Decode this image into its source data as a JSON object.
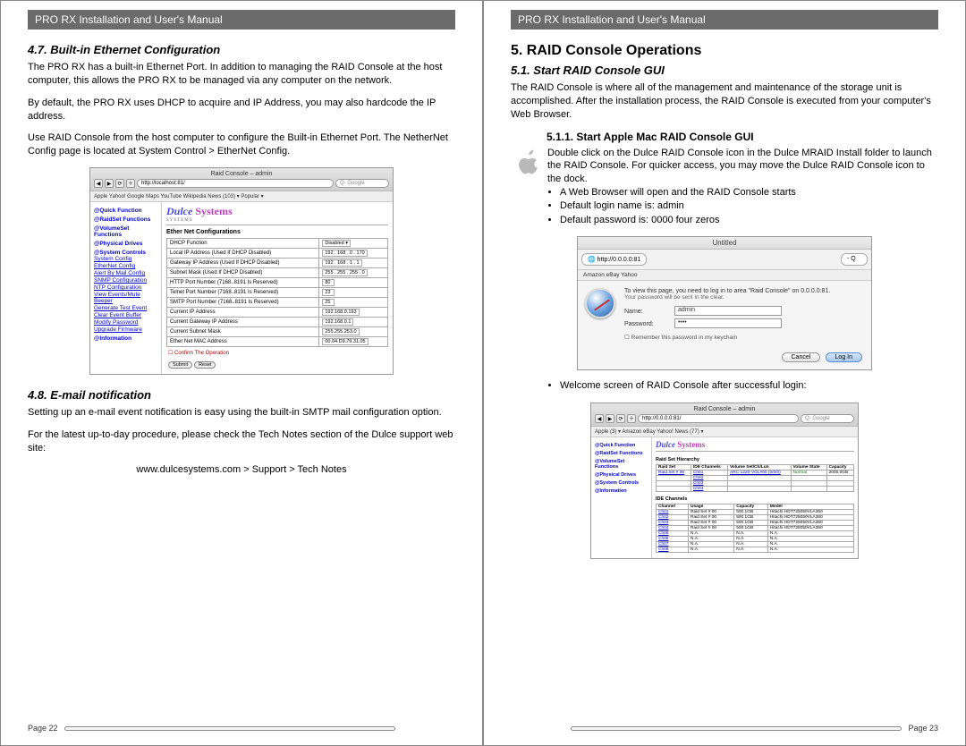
{
  "header": "PRO RX Installation and User's Manual",
  "left": {
    "sec47": "4.7.    Built-in Ethernet Configuration",
    "p47a": "The PRO RX has a built-in Ethernet Port.  In addition to managing the RAID Console at the host computer, this allows the PRO RX to be managed via any computer on the network.",
    "p47b": "By default, the PRO RX uses DHCP to acquire and IP Address, you may also hardcode the IP address.",
    "p47c": "Use RAID Console from the host computer to configure the Built-in Ethernet Port. The NetherNet Config page is located at System Control > EtherNet Config.",
    "sec48": "4.8.    E-mail notification",
    "p48a": "Setting up an e-mail event notification is easy using the built-in SMTP mail configuration option.",
    "p48b": "For the latest up-to-day procedure, please check the Tech Notes section of the Dulce support web site:",
    "p48link": "www.dulcesystems.com > Support > Tech Notes",
    "page_num": "Page 22"
  },
  "right": {
    "h5": "5. RAID Console Operations",
    "sec51": "5.1.    Start RAID Console GUI",
    "p51": "The RAID Console is where all of the management and maintenance of the storage unit is accomplished.  After the installation process, the RAID Console is executed from your computer's Web Browser.",
    "sec511": "5.1.1. Start Apple Mac RAID Console GUI",
    "p511": "Double click on the Dulce RAID Console icon in the Dulce MRAID Install folder to launch the RAID Console.  For quicker access, you may move the Dulce RAID Console icon to the dock.",
    "bullets": [
      "A Web Browser will open and the RAID Console starts",
      "Default login name is: admin",
      "Default password is: 0000   four zeros"
    ],
    "after_login": "Welcome screen of RAID Console after successful login:",
    "page_num": "Page 23"
  },
  "shot1": {
    "window_title": "Raid Console – admin",
    "url": "http://localhost:81/",
    "search_ph": "Google",
    "bookmarks": "Apple   Yahoo!   Google Maps   YouTube   Wikipedia   News (103) ▾   Popular ▾",
    "sidebar": {
      "quick": "@Quick Function",
      "rsf": "@RaidSet Functions",
      "vsf": "@VolumeSet Functions",
      "pd": "@Physical Drives",
      "sc": "@System Controls",
      "sc_items": [
        "System Config",
        "EtherNet Config",
        "Alert By Mail Config",
        "SNMP Configuration",
        "NTP Configuration",
        "View Events/Mute Beeper",
        "Generate Test Event",
        "Clear Event Buffer",
        "Modify Password",
        "Upgrade Firmware"
      ],
      "info": "@Information"
    },
    "logo_main": "Dulce",
    "logo_sub": "Systems",
    "form_title": "Ether Net Configurations",
    "rows": [
      {
        "label": "DHCP Function",
        "val": "Disabled ▾"
      },
      {
        "label": "Local IP Address (Used If DHCP Disabled)",
        "val": "192 . 168 . 0 . 170"
      },
      {
        "label": "Gateway IP Address (Used If DHCP Disabled)",
        "val": "192 . 168 . 1 . 1"
      },
      {
        "label": "Subnet Mask (Used If DHCP Disabled)",
        "val": "255 . 255 . 255 . 0"
      },
      {
        "label": "HTTP Port Number (7168..8191 Is Reserved)",
        "val": "80"
      },
      {
        "label": "Telnet Port Number (7168..8191 Is Reserved)",
        "val": "23"
      },
      {
        "label": "SMTP Port Number (7168..8191 Is Reserved)",
        "val": "25"
      },
      {
        "label": "Current IP Address",
        "val": "192.168.0.193"
      },
      {
        "label": "Current Gateway IP Address",
        "val": "192.168.0.1"
      },
      {
        "label": "Current Subnet Mask",
        "val": "255.255.253.0"
      },
      {
        "label": "Ether Net MAC Address",
        "val": "00.04.D9.79.31.05"
      }
    ],
    "confirm": "☐ Confirm The Operation",
    "submit": "Submit",
    "reset": "Reset"
  },
  "shot2": {
    "title": "Untitled",
    "url": "http://0.0.0.0:81",
    "bar2": "Amazon   eBay   Yahoo",
    "line1": "To view this page, you need to log in to area \"Raid Console\" on 0.0.0.0:81.",
    "line2": "Your password will be sent in the clear.",
    "name_lbl": "Name:",
    "name_val": "admin",
    "pw_lbl": "Password:",
    "pw_val": "••••",
    "remember": "Remember this password in my keychain",
    "cancel": "Cancel",
    "login": "Log In"
  },
  "shot3": {
    "window_title": "Raid Console – admin",
    "url": "http://0.0.0.0:81/",
    "bookmarks": "Apple (3) ▾   Amazon   eBay   Yahoo!   News (77) ▾",
    "sidebar": [
      "@Quick Function",
      "@RaidSet Functions",
      "@VolumeSet Functions",
      "@Physical Drives",
      "@System Controls",
      "@Information"
    ],
    "hier": "Raid Set Hierarchy",
    "raidset_hdr": [
      "Raid Set",
      "IDE Channels",
      "Volume Set/Ch/Lun",
      "Volume State",
      "Capacity"
    ],
    "raidset_rows": [
      [
        "Raid Set # 00",
        "Ch01",
        "ARC-1220-VOL#00 (0/0/0)",
        "Normal",
        "2000.0GB"
      ],
      [
        "",
        "Ch02",
        "",
        "",
        ""
      ],
      [
        "",
        "Ch03",
        "",
        "",
        ""
      ],
      [
        "",
        "Ch04",
        "",
        "",
        ""
      ]
    ],
    "ide_lbl": "IDE Channels",
    "ide_hdr": [
      "Channel",
      "Usage",
      "Capacity",
      "Model"
    ],
    "ide_rows": [
      [
        "Ch01",
        "Raid Set # 00",
        "500.1GB",
        "Hitachi HDT725050VLA360"
      ],
      [
        "Ch02",
        "Raid Set # 00",
        "500.1GB",
        "Hitachi HDT725050VLA360"
      ],
      [
        "Ch03",
        "Raid Set # 00",
        "500.1GB",
        "Hitachi HDT725050VLA360"
      ],
      [
        "Ch04",
        "Raid Set # 00",
        "500.1GB",
        "Hitachi HDT725050VLA360"
      ],
      [
        "Ch05",
        "N.A.",
        "N.A.",
        "N.A."
      ],
      [
        "Ch06",
        "N.A.",
        "N.A.",
        "N.A."
      ],
      [
        "Ch07",
        "N.A.",
        "N.A.",
        "N.A."
      ],
      [
        "Ch08",
        "N.A.",
        "N.A.",
        "N.A."
      ]
    ]
  }
}
